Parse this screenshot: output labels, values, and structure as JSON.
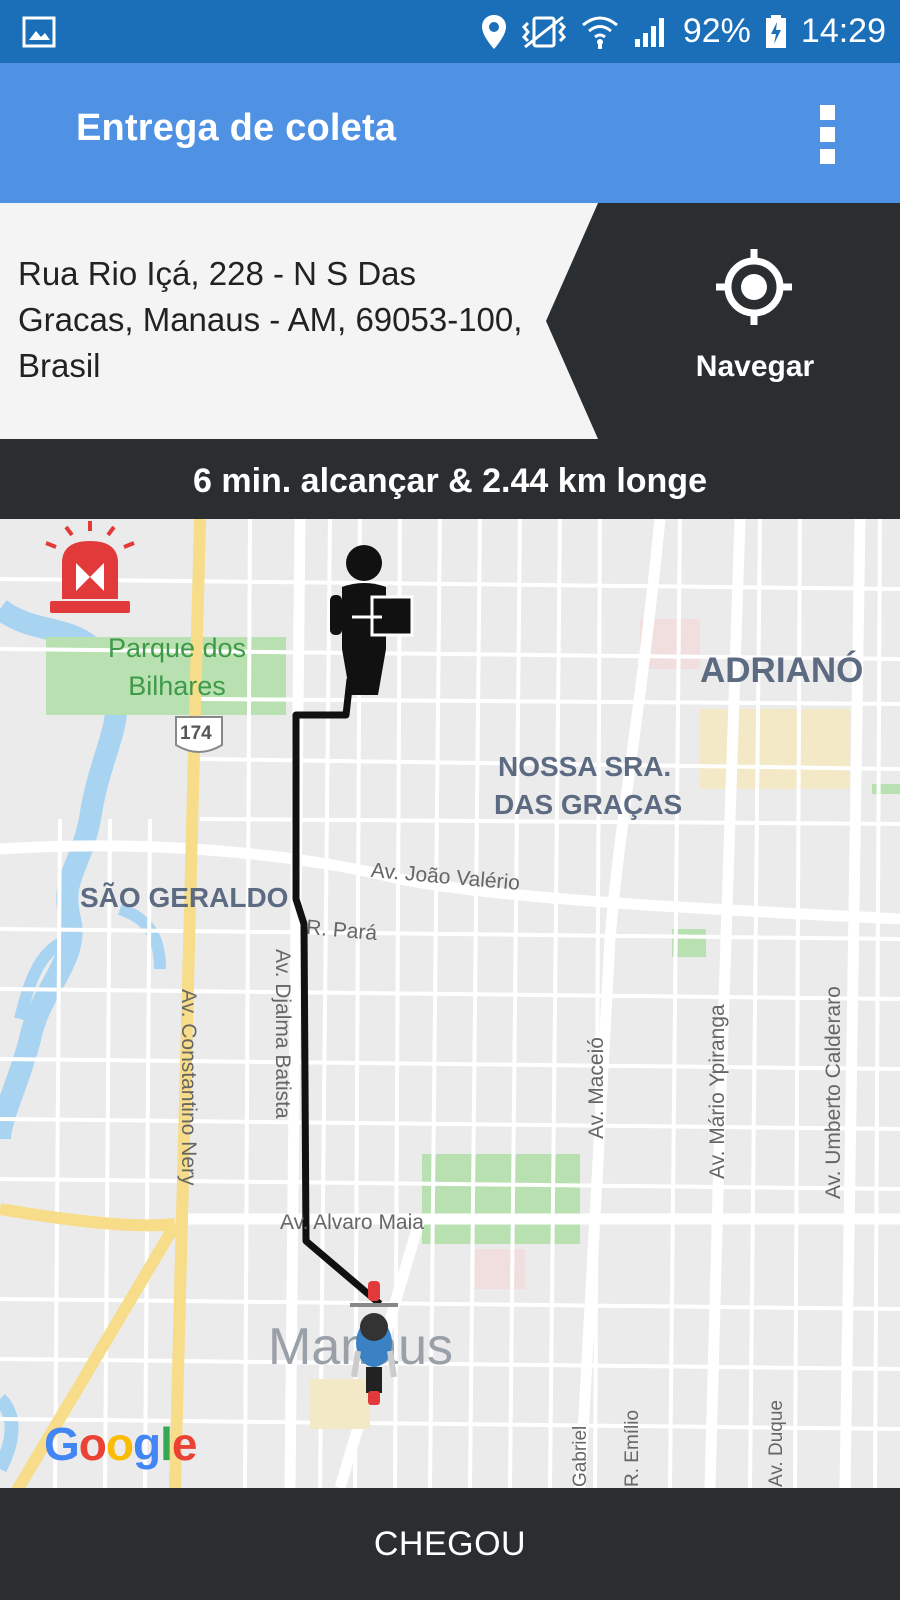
{
  "status_bar": {
    "battery": "92%",
    "time": "14:29",
    "icons": [
      "image-icon",
      "location-icon",
      "vibrate-icon",
      "wifi-icon",
      "signal-icon",
      "battery-charging-icon"
    ]
  },
  "app_bar": {
    "title": "Entrega de coleta",
    "menu_icon": "more-vert-icon"
  },
  "address": {
    "text": "Rua Rio Içá, 228 - N S Das Gracas, Manaus - AM, 69053-100, Brasil"
  },
  "navigate": {
    "label": "Navegar",
    "icon": "gps-target-icon"
  },
  "eta": {
    "text": "6 min. alcançar & 2.44 km longe"
  },
  "map": {
    "labels": {
      "parque": "Parque dos Bilhares",
      "adrianopolis": "ADRIANÓ",
      "nossa_sra_1": "NOSSA SRA.",
      "nossa_sra_2": "DAS GRAÇAS",
      "sao_geraldo": "SÃO GERALDO",
      "joao_valerio": "Av. João Valério",
      "para": "R. Pará",
      "djalma": "Av. Djalma Batista",
      "constantino": "Av. Constantino Nery",
      "maceio": "Av. Maceió",
      "ypiranga": "Av. Mário Ypiranga",
      "calderaro": "Av. Umberto Calderaro",
      "alvaro_maia": "Av. Alvaro Maia",
      "manaus": "Manaus",
      "route_174": "174",
      "emilio": "R. Emílio",
      "duque": "Av. Duque",
      "gabriel": "Gabriel"
    },
    "logo": "Google",
    "icons": [
      "alarm-siren-icon",
      "delivery-person-icon",
      "motorbike-rider-icon"
    ],
    "colors": {
      "route": "#111111",
      "park": "#b8e0b0",
      "water": "#a8d4f2",
      "major_road": "#f7dc8a"
    }
  },
  "bottom_button": {
    "label": "CHEGOU"
  }
}
